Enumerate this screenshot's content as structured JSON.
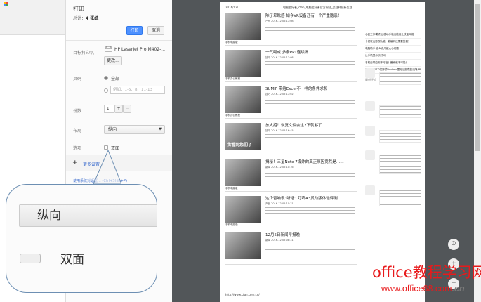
{
  "panel": {
    "title": "打印",
    "total_label": "总计：",
    "total_value": "4 张纸",
    "print_button": "打印",
    "cancel_button": "取消",
    "destination_label": "目标打印机",
    "printer_name": "HP LaserJet Pro M402-...",
    "change_button": "更改...",
    "pages_label": "页码",
    "pages_all": "全部",
    "pages_placeholder": "例如：1-5、8、11-13",
    "copies_label": "份数",
    "copies_value": "1",
    "copies_plus": "+",
    "copies_minus": "−",
    "layout_label": "布局",
    "layout_value": "纵向",
    "options_label": "选项",
    "duplex_label": "双面",
    "more_settings": "更多设置",
    "system_dialog_link": "使用系统对话框...",
    "system_dialog_shortcut": "(Ctrl+Shift+P)"
  },
  "callout": {
    "layout_value": "纵向",
    "duplex_label": "双面"
  },
  "preview": {
    "date": "2016/12/7",
    "page_title": "电脑爱好者_cfan_电脑爱好者官方网站_关注科技新生活",
    "footer_url": "http://www.cfan.com.cn/",
    "articles": [
      {
        "title": "除了晕眩感 如今VR设备还有一个严重隐患！",
        "meta": "产品  2016-12-06 17:08",
        "caption": "手机电脑版"
      },
      {
        "title": "一气呵成 多条PPT连续做",
        "meta": "技巧  2016-12-05 17:08",
        "caption": "手机办公教程"
      },
      {
        "title": "SUMIF 带给Excel不一样的条件求和",
        "meta": "技巧  2016-12-05 17:02",
        "caption": "手机办公教程"
      },
      {
        "title": "放大招！恢复文件会这2下就够了",
        "meta": "技巧  2016-12-05 16:45",
        "caption": ""
      },
      {
        "title": "揭秘！三星Note 7爆炸的真正原因竟然是……",
        "meta": "新闻  2016-12-05 10:16",
        "caption": "手机电脑版"
      },
      {
        "title": "这个音响很“听话” 叮咚A3灵动版体验评测",
        "meta": "产品  2016-12-05 10:31",
        "caption": "手机电脑版"
      },
      {
        "title": "12月5日新闻早报晚",
        "meta": "新闻  2016-12-05 08:31",
        "caption": ""
      }
    ],
    "thumb_overlay": "我看到您们了",
    "sidebar_links": [
      "小区工作模式 让移动手机也能用上快速网络",
      "卡们发出影视功能！能编码还需要的量？",
      "电脑助手 这么说几键大小问题",
      "让手机显示长时间",
      "手机自带应用不可信！傲娇就不可能！",
      "无需ROOT 2招干掉Android里无法卸载的流氓APP"
    ],
    "comments_title": "最新评论"
  },
  "watermark": {
    "line1": "office教程学习网",
    "line2": "www.office68.com",
    "line2_suffix": ".cn"
  }
}
